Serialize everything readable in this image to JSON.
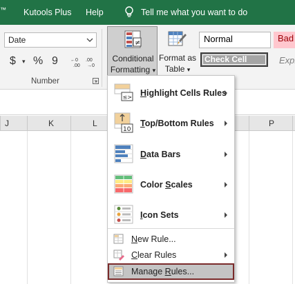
{
  "tabs": {
    "trademark": "™",
    "kutools_plus": "Kutools Plus",
    "help": "Help",
    "tell_me": "Tell me what you want to do"
  },
  "ribbon": {
    "number_format_value": "Date",
    "currency_symbol": "$",
    "percent_symbol": "%",
    "comma_symbol": "9",
    "number_group_label": "Number",
    "conditional_formatting_line1": "Conditional",
    "conditional_formatting_line2": "Formatting",
    "format_as_table_line1": "Format as",
    "format_as_table_line2": "Table",
    "styles": {
      "normal": "Normal",
      "bad": "Bad",
      "check_cell": "Check Cell",
      "explanatory": "Expl"
    }
  },
  "columns": [
    "J",
    "K",
    "L",
    "P"
  ],
  "menu": {
    "items": [
      {
        "label_pre": "",
        "label_key": "H",
        "label_post": "ighlight Cells Rules"
      },
      {
        "label_pre": "",
        "label_key": "T",
        "label_post": "op/Bottom Rules"
      },
      {
        "label_pre": "",
        "label_key": "D",
        "label_post": "ata Bars"
      },
      {
        "label_pre": "Color ",
        "label_key": "S",
        "label_post": "cales"
      },
      {
        "label_pre": "",
        "label_key": "I",
        "label_post": "con Sets"
      }
    ],
    "new_rule": {
      "label_pre": "",
      "label_key": "N",
      "label_post": "ew Rule..."
    },
    "clear_rules": {
      "label_pre": "",
      "label_key": "C",
      "label_post": "lear Rules"
    },
    "manage_rules": {
      "label_pre": "Manage ",
      "label_key": "R",
      "label_post": "ules..."
    },
    "icon_texts": {
      "ge": "≤>",
      "ten": "10"
    }
  },
  "colors": {
    "excel_green": "#217346",
    "selected_border": "#7a2a2a",
    "bad_fill": "#ffc7ce",
    "bad_text": "#9c0006"
  }
}
